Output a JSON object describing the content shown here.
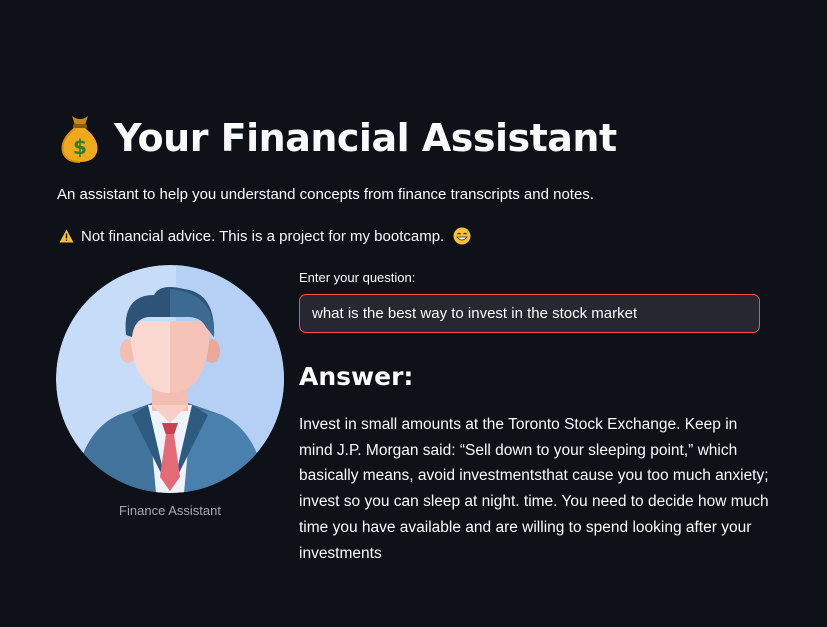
{
  "header": {
    "title": "Your Financial Assistant",
    "title_icon": "money-bag-icon",
    "subtitle": "An assistant to help you understand concepts from finance transcripts and notes.",
    "warning_icon": "warning-icon",
    "warning_text": "Not financial advice. This is a project for my bootcamp.",
    "warning_emoji": "grinning-sweat-face-icon"
  },
  "avatar": {
    "icon": "businessman-avatar-icon",
    "caption": "Finance Assistant"
  },
  "question": {
    "label": "Enter your question:",
    "value": "what is the best way to invest in the stock market"
  },
  "answer": {
    "heading": "Answer:",
    "text": "Invest in small amounts at the Toronto Stock Exchange. Keep in mind J.P. Morgan said: “Sell down to your sleeping point,” which basically means, avoid investmentsthat cause you too much anxiety; invest so you can sleep at night. time. You need to decide how much time you have available and are willing to spend looking after your investments"
  },
  "colors": {
    "background": "#0e1117",
    "input_border_focus": "#ff4b4b",
    "input_background": "#262730",
    "avatar_background": "#c7dcf8"
  }
}
